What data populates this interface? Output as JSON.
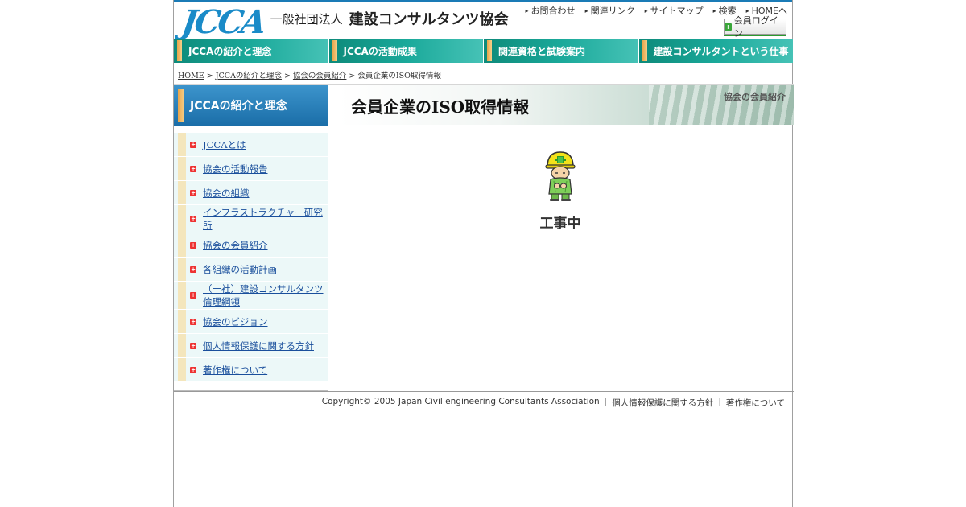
{
  "header": {
    "logo_mark": "JCCA",
    "org_type": "一般社団法人",
    "org_name": "建設コンサルタンツ協会",
    "utility_links": [
      "お問合わせ",
      "関連リンク",
      "サイトマップ",
      "検索",
      "HOMEへ"
    ],
    "login_label": "会員ログイン"
  },
  "global_nav": [
    "JCCAの紹介と理念",
    "JCCAの活動成果",
    "関連資格と試験案内",
    "建設コンサルタントという仕事"
  ],
  "breadcrumb": {
    "items": [
      "HOME",
      "JCCAの紹介と理念",
      "協会の会員紹介"
    ],
    "current": "会員企業のISO取得情報",
    "separator": ">"
  },
  "sidebar": {
    "title": "JCCAの紹介と理念",
    "items": [
      "JCCAとは",
      "協会の活動報告",
      "協会の組織",
      "インフラストラクチャー研究所",
      "協会の会員紹介",
      "各組織の活動計画",
      "（一社）建設コンサルタンツ倫理綱領",
      "協会のビジョン",
      "個人情報保護に関する方針",
      "著作権について"
    ]
  },
  "main": {
    "title": "会員企業のISO取得情報",
    "section": "協会の会員紹介",
    "status": "工事中"
  },
  "footer": {
    "copyright": "Copyright© 2005 Japan Civil engineering Consultants Association",
    "links": [
      "個人情報保護に関する方針",
      "著作権について"
    ]
  },
  "colors": {
    "brand_blue": "#1a7bb6",
    "nav_teal": "#1aa99a",
    "accent_orange": "#e9a54a",
    "link": "#1a4f9c"
  }
}
